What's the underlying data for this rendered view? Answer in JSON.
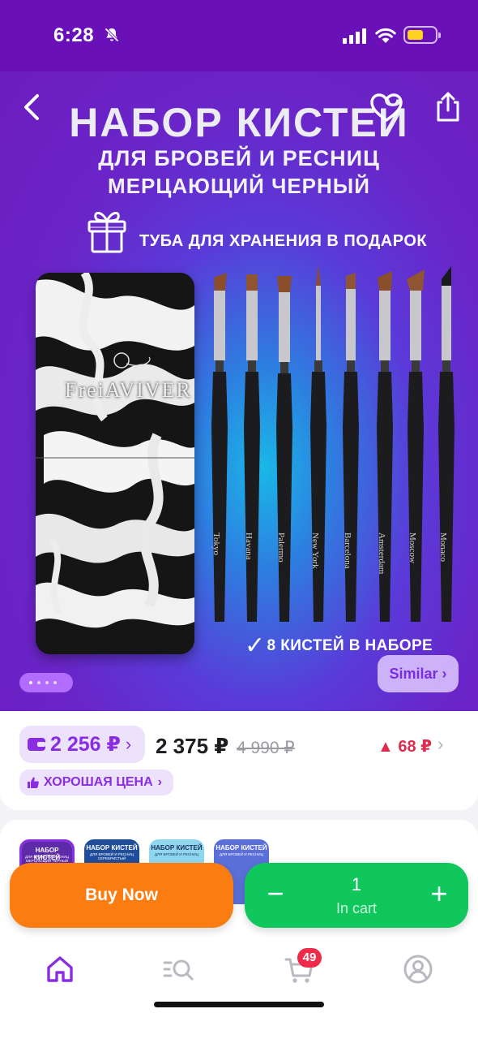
{
  "status_bar": {
    "time": "6:28",
    "icons": [
      "bell-slash-icon",
      "signal-icon",
      "wifi-icon",
      "battery-icon"
    ],
    "battery_color": "#ffd21e"
  },
  "hero": {
    "title": "НАБОР КИСТЕЙ",
    "subtitle_1": "ДЛЯ БРОВЕЙ И РЕСНИЦ",
    "subtitle_2": "МЕРЦАЮЩИЙ ЧЕРНЫЙ",
    "gift_text": "ТУБА ДЛЯ ХРАНЕНИЯ В ПОДАРОК",
    "tube_brand": "FreiAVIVER",
    "brush_names": [
      "Tokyo",
      "Havana",
      "Palermo",
      "New York",
      "Barcelona",
      "Amsterdam",
      "Moscow",
      "Monaco"
    ],
    "count_text": "8 КИСТЕЙ В НАБОРЕ",
    "check_glyph": "✓",
    "similar_label": "Similar ›",
    "gallery": {
      "pages": 4,
      "current": 1
    }
  },
  "price": {
    "wallet_price": "2 256 ₽",
    "wallet_chevron": "›",
    "current": "2 375 ₽",
    "old": "4 990 ₽",
    "change": "▲ 68 ₽",
    "change_chevron": "›",
    "badge": "ХОРОШАЯ ЦЕНА",
    "badge_chevron": "›"
  },
  "variants": [
    {
      "title": "НАБОР КИСТЕЙ",
      "sub": "ДЛЯ БРОВЕЙ И РЕСНИЦ МЕРЦАЮЩИЙ ЧЕРНЫЙ",
      "bg": "#5d2aa8",
      "fg": "#ffffff",
      "selected": true
    },
    {
      "title": "НАБОР КИСТЕЙ",
      "sub": "ДЛЯ БРОВЕЙ И РЕСНИЦ СЕРЕБРИСТЫЙ",
      "bg": "#1f4d9a",
      "fg": "#ffffff",
      "selected": false
    },
    {
      "title": "НАБОР КИСТЕЙ",
      "sub": "ДЛЯ БРОВЕЙ И РЕСНИЦ",
      "bg": "#8fd7ee",
      "fg": "#1a2f5a",
      "selected": false
    },
    {
      "title": "НАБОР КИСТЕЙ",
      "sub": "ДЛЯ БРОВЕЙ И РЕСНИЦ",
      "bg": "#5b6fd8",
      "fg": "#ffffff",
      "selected": false
    }
  ],
  "actions": {
    "buy_now": "Buy Now",
    "quantity": "1",
    "in_cart": "In cart",
    "minus": "−",
    "plus": "+"
  },
  "nav": {
    "items": [
      "home-icon",
      "catalog-search-icon",
      "cart-icon",
      "profile-icon"
    ],
    "cart_badge": "49"
  },
  "colors": {
    "brand_purple": "#6a10b8",
    "accent_purple": "#8a2de2",
    "buy_orange": "#fb7c10",
    "cart_green": "#10c75e",
    "price_up_red": "#e02c4c"
  }
}
